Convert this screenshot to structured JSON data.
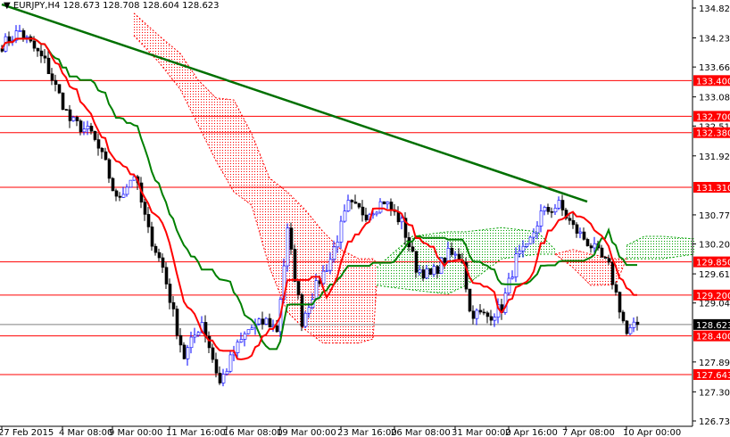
{
  "header": {
    "symbol": "EURJPY,H4",
    "ohlc": "128.673 128.708 128.604 128.623"
  },
  "colors": {
    "bull_candle": "#0000ff",
    "bear_candle": "#000000",
    "tenkan": "#ff0000",
    "kijun": "#008000",
    "trendline": "#007000",
    "level": "#ff0000",
    "cloud_bear": "#ff0000",
    "cloud_bull": "#00a000",
    "current": "#808080"
  },
  "chart_data": {
    "type": "candlestick",
    "title": "EURJPY,H4",
    "ylim": [
      126.735,
      134.82
    ],
    "y_ticks": [
      "134.820",
      "134.235",
      "133.665",
      "133.080",
      "132.510",
      "131.925",
      "130.770",
      "130.200",
      "129.615",
      "129.045",
      "127.890",
      "127.305",
      "126.735"
    ],
    "x_ticks": [
      {
        "i": 0,
        "label": "27 Feb 2015"
      },
      {
        "i": 17,
        "label": "4 Mar 08:00"
      },
      {
        "i": 31,
        "label": "9 Mar 00:00"
      },
      {
        "i": 47,
        "label": "11 Mar 16:00"
      },
      {
        "i": 63,
        "label": "16 Mar 08:00"
      },
      {
        "i": 78,
        "label": "19 Mar 00:00"
      },
      {
        "i": 95,
        "label": "23 Mar 16:00"
      },
      {
        "i": 110,
        "label": "26 Mar 08:00"
      },
      {
        "i": 127,
        "label": "31 Mar 00:00"
      },
      {
        "i": 142,
        "label": "2 Apr 16:00"
      },
      {
        "i": 158,
        "label": "7 Apr 08:00"
      },
      {
        "i": 175,
        "label": "10 Apr 00:00"
      }
    ],
    "close_keypoints": [
      [
        0,
        134.1
      ],
      [
        5,
        134.37
      ],
      [
        12,
        133.76
      ],
      [
        19,
        132.62
      ],
      [
        25,
        132.36
      ],
      [
        29,
        131.75
      ],
      [
        32,
        131.05
      ],
      [
        37,
        131.57
      ],
      [
        41,
        130.44
      ],
      [
        45,
        129.74
      ],
      [
        49,
        128.52
      ],
      [
        51,
        127.99
      ],
      [
        56,
        128.69
      ],
      [
        61,
        127.47
      ],
      [
        65,
        128.08
      ],
      [
        69,
        128.52
      ],
      [
        74,
        128.69
      ],
      [
        77,
        128.52
      ],
      [
        80,
        130.44
      ],
      [
        84,
        128.69
      ],
      [
        87,
        129.22
      ],
      [
        92,
        129.91
      ],
      [
        97,
        130.96
      ],
      [
        102,
        130.79
      ],
      [
        107,
        131.05
      ],
      [
        112,
        130.61
      ],
      [
        116,
        129.74
      ],
      [
        120,
        129.57
      ],
      [
        125,
        130.0
      ],
      [
        129,
        129.91
      ],
      [
        131,
        128.87
      ],
      [
        136,
        128.78
      ],
      [
        140,
        128.95
      ],
      [
        144,
        129.91
      ],
      [
        147,
        130.09
      ],
      [
        151,
        130.79
      ],
      [
        156,
        130.96
      ],
      [
        160,
        130.52
      ],
      [
        165,
        130.17
      ],
      [
        170,
        129.74
      ],
      [
        172,
        129.22
      ],
      [
        175,
        128.43
      ],
      [
        178,
        128.623
      ]
    ],
    "levels": [
      {
        "price": 133.4,
        "label": "133.400"
      },
      {
        "price": 132.7,
        "label": "132.700"
      },
      {
        "price": 132.38,
        "label": "132.380"
      },
      {
        "price": 131.31,
        "label": "131.310"
      },
      {
        "price": 129.85,
        "label": "129.850"
      },
      {
        "price": 129.2,
        "label": "129.200"
      },
      {
        "price": 128.4,
        "label": "128.400"
      },
      {
        "price": 127.643,
        "label": "127.643"
      }
    ],
    "current_price": {
      "price": 128.623,
      "label": "128.623"
    },
    "trendline": [
      [
        0,
        134.89
      ],
      [
        164,
        131.03
      ]
    ],
    "cloud": [
      {
        "seg": "bear",
        "pts": [
          [
            37,
            134.72,
            134.28
          ],
          [
            44,
            134.28,
            133.76
          ],
          [
            50,
            133.93,
            133.23
          ],
          [
            55,
            133.41,
            132.53
          ],
          [
            60,
            133.06,
            131.83
          ],
          [
            65,
            133.02,
            131.22
          ],
          [
            70,
            132.36,
            130.96
          ],
          [
            75,
            131.49,
            129.74
          ],
          [
            80,
            131.22,
            128.87
          ],
          [
            85,
            130.87,
            128.52
          ],
          [
            90,
            130.44,
            128.26
          ],
          [
            95,
            130.09,
            128.26
          ],
          [
            100,
            129.91,
            128.26
          ],
          [
            104,
            129.91,
            128.34
          ],
          [
            105,
            129.83,
            129.39
          ]
        ]
      },
      {
        "seg": "bull",
        "pts": [
          [
            105,
            129.74,
            129.39
          ],
          [
            115,
            130.35,
            129.3
          ],
          [
            125,
            130.44,
            129.22
          ],
          [
            130,
            130.44,
            129.39
          ],
          [
            140,
            130.52,
            129.91
          ],
          [
            150,
            130.44,
            130.0
          ],
          [
            155,
            130.09,
            130.0
          ]
        ]
      },
      {
        "seg": "bear",
        "pts": [
          [
            155,
            130.0,
            130.0
          ],
          [
            160,
            130.09,
            129.74
          ],
          [
            165,
            130.0,
            129.39
          ],
          [
            172,
            129.91,
            129.4
          ],
          [
            175,
            129.91,
            129.91
          ]
        ]
      },
      {
        "seg": "bull",
        "pts": [
          [
            175,
            130.17,
            129.91
          ],
          [
            180,
            130.35,
            129.91
          ],
          [
            185,
            130.35,
            129.91
          ],
          [
            194,
            130.3,
            130.0
          ]
        ]
      }
    ]
  }
}
